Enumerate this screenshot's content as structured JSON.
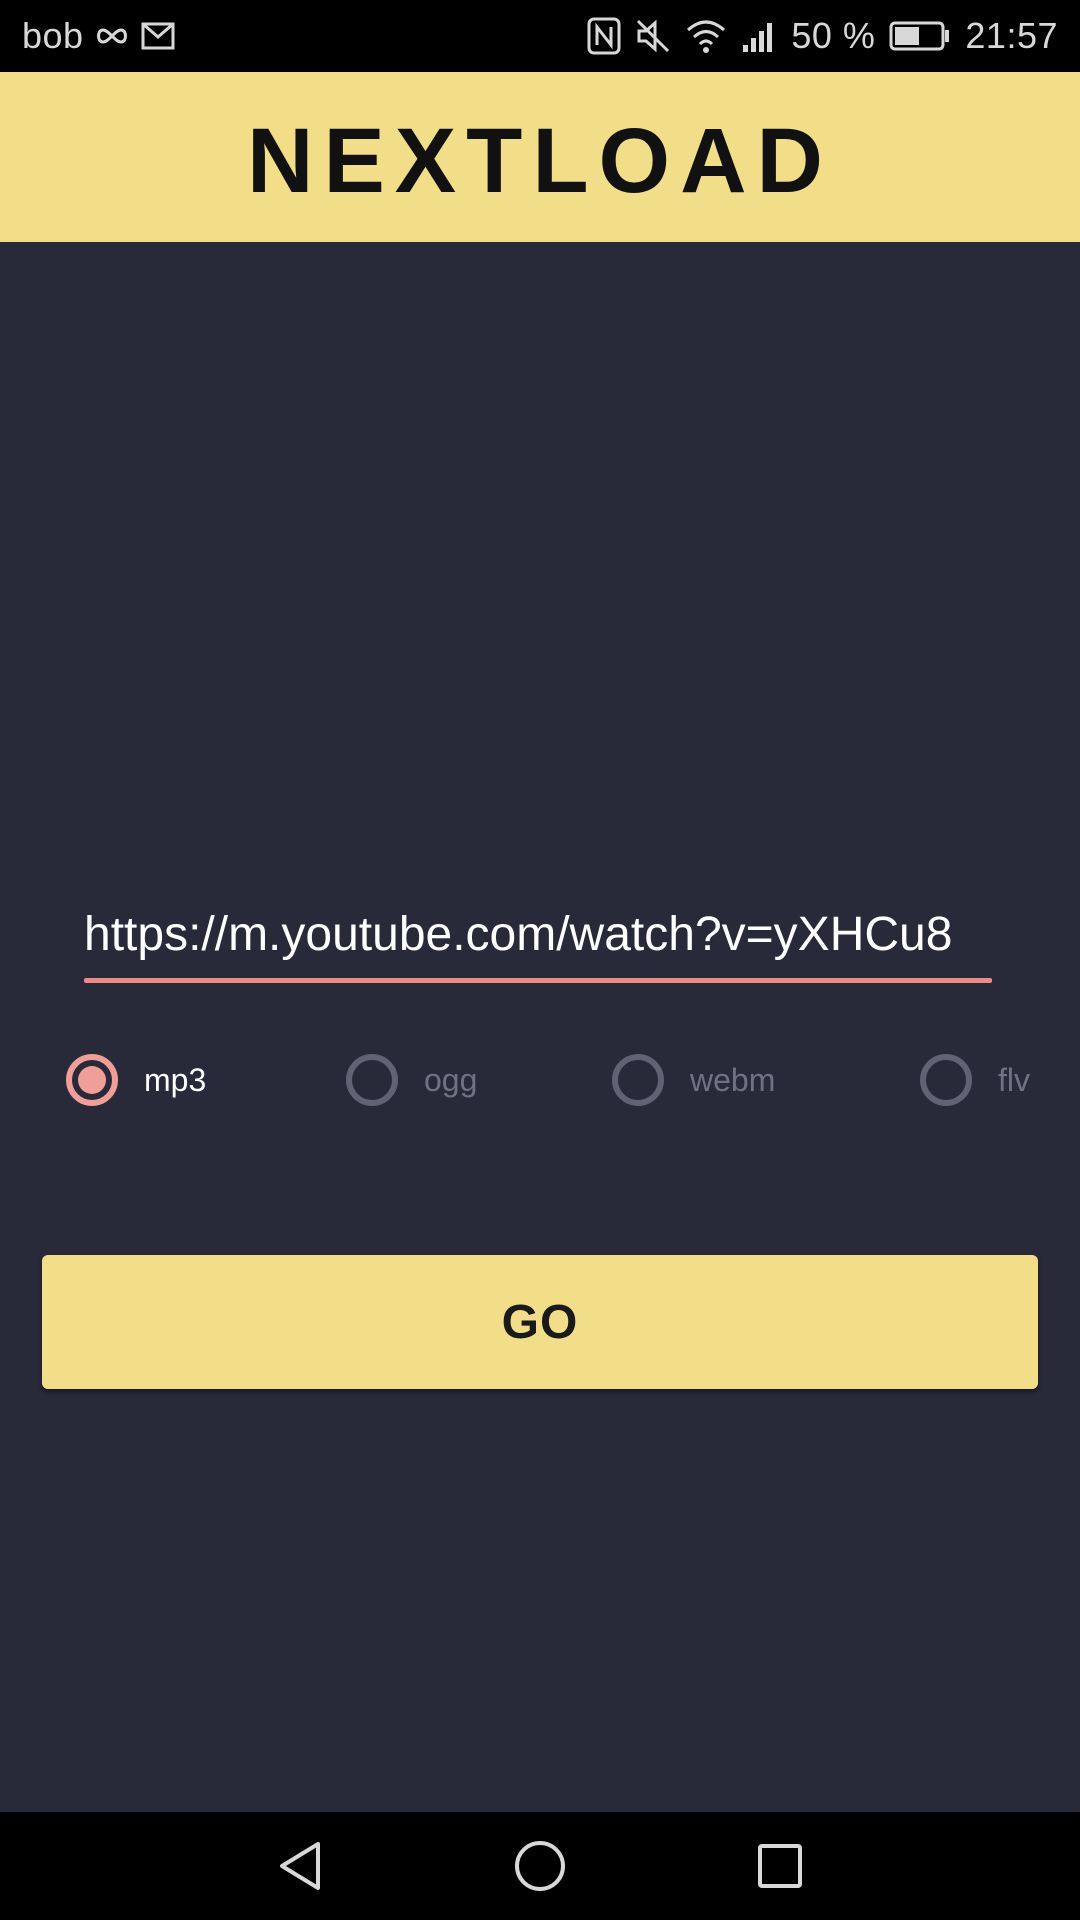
{
  "status_bar": {
    "carrier": "bob",
    "battery_percent": "50 %",
    "time": "21:57"
  },
  "header": {
    "logo_text": "NEXTLOAD"
  },
  "main": {
    "url_value": "https://m.youtube.com/watch?v=yXHCu8",
    "formats": [
      {
        "label": "mp3",
        "selected": true
      },
      {
        "label": "ogg",
        "selected": false
      },
      {
        "label": "webm",
        "selected": false
      },
      {
        "label": "flv",
        "selected": false
      }
    ],
    "go_label": "GO"
  },
  "colors": {
    "background": "#282939",
    "accent_yellow": "#f2de89",
    "accent_pink": "#ec8b86"
  },
  "icons": [
    "infinity-icon",
    "mail-icon",
    "nfc-icon",
    "mute-icon",
    "wifi-icon",
    "signal-icon",
    "battery-icon",
    "back-icon",
    "home-icon",
    "recents-icon"
  ]
}
